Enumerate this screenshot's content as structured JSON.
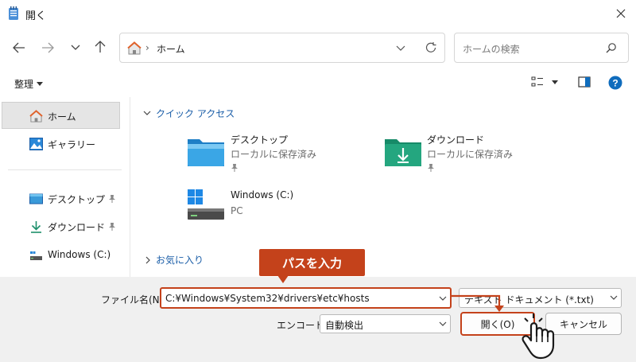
{
  "window": {
    "title": "開く"
  },
  "address": {
    "breadcrumb": "ホーム"
  },
  "search": {
    "placeholder": "ホームの検索"
  },
  "toolbar": {
    "organize_label": "整理"
  },
  "sidebar": {
    "items": [
      {
        "label": "ホーム"
      },
      {
        "label": "ギャラリー"
      },
      {
        "label": "デスクトップ"
      },
      {
        "label": "ダウンロード"
      },
      {
        "label": "Windows (C:)"
      }
    ]
  },
  "main": {
    "quick_access": {
      "header": "クイック アクセス",
      "tiles": [
        {
          "title": "デスクトップ",
          "subtitle": "ローカルに保存済み"
        },
        {
          "title": "ダウンロード",
          "subtitle": "ローカルに保存済み"
        },
        {
          "title": "Windows (C:)",
          "subtitle": "PC"
        }
      ]
    },
    "favorites": {
      "header": "お気に入り"
    }
  },
  "footer": {
    "filename_label": "ファイル名(N):",
    "filename_value": "C:¥Windows¥System32¥drivers¥etc¥hosts",
    "filetype_value": "テキスト ドキュメント (*.txt)",
    "encoding_label": "エンコード:",
    "encoding_value": "自動検出",
    "open_button": "開く(O)",
    "cancel_button": "キャンセル"
  },
  "annotation": {
    "callout": "パスを入力"
  },
  "colors": {
    "accent": "#c4421b",
    "link": "#1b5ea8",
    "help": "#0f6cbd"
  }
}
